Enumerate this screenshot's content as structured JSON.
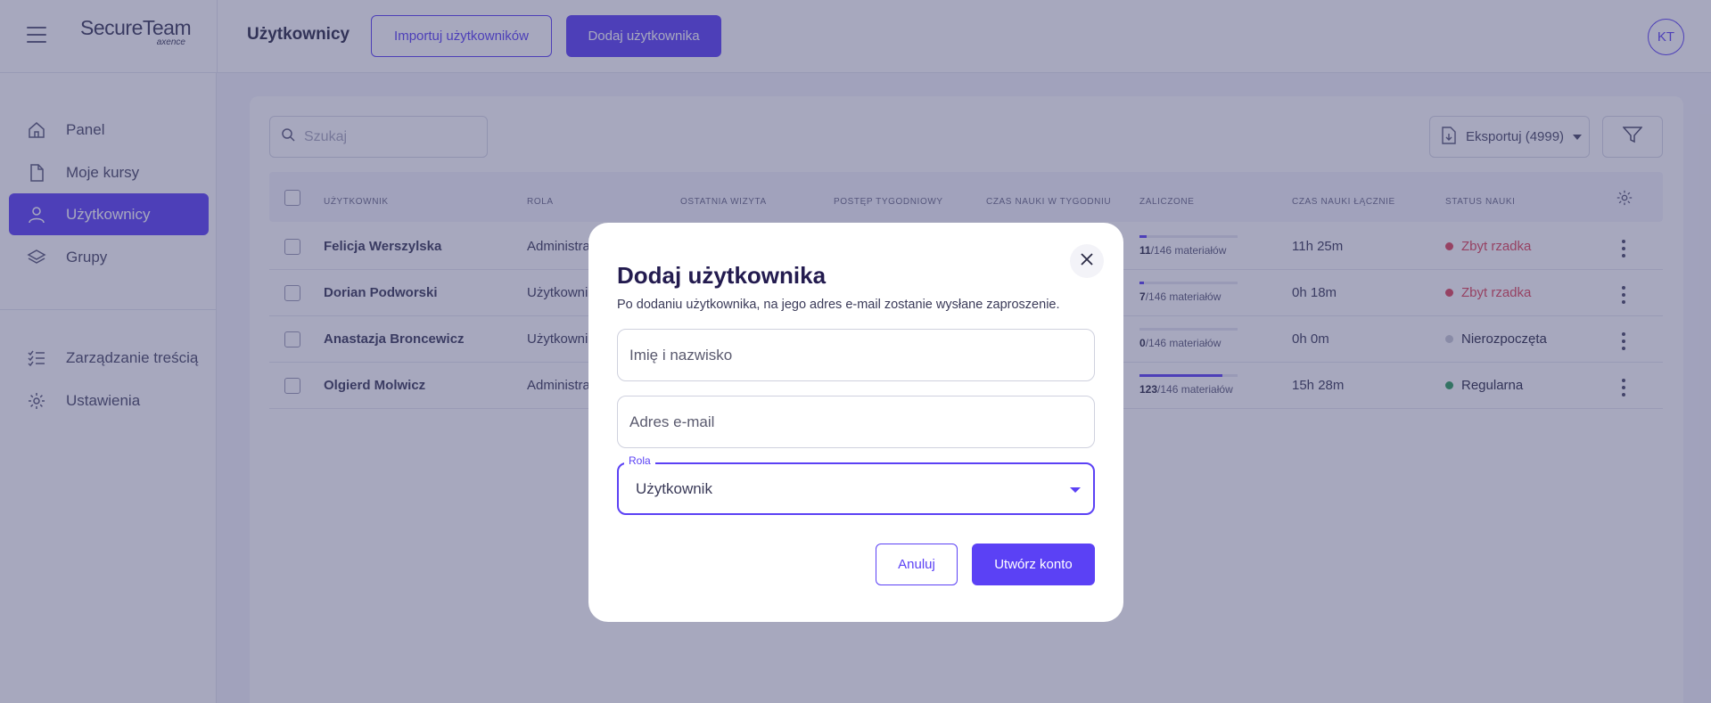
{
  "app": {
    "logo_main": "SecureTeam",
    "logo_sub": "axence",
    "page_title": "Użytkownicy",
    "import_label": "Importuj użytkowników",
    "add_label": "Dodaj użytkownika",
    "avatar_initials": "KT"
  },
  "sidebar": {
    "items": [
      {
        "label": "Panel",
        "icon": "home-icon"
      },
      {
        "label": "Moje kursy",
        "icon": "document-icon"
      },
      {
        "label": "Użytkownicy",
        "icon": "user-icon",
        "active": true
      },
      {
        "label": "Grupy",
        "icon": "layers-icon"
      },
      {
        "label": "Zarządzanie treścią",
        "icon": "list-check-icon"
      },
      {
        "label": "Ustawienia",
        "icon": "gear-icon"
      }
    ]
  },
  "toolbar": {
    "search_placeholder": "Szukaj",
    "export_label": "Eksportuj (4999)"
  },
  "table": {
    "headers": [
      "UŻYTKOWNIK",
      "ROLA",
      "OSTATNIA WIZYTA",
      "POSTĘP TYGODNIOWY",
      "CZAS NAUKI W TYGODNIU",
      "ZALICZONE",
      "CZAS NAUKI ŁĄCZNIE",
      "STATUS NAUKI"
    ],
    "rows": [
      {
        "name": "Felicja Werszylska",
        "role": "Administra",
        "completed": "11",
        "total": "/146 materiałów",
        "progress": 0.075,
        "total_time": "11h 25m",
        "status": "Zbyt rzadka",
        "status_color": "#e0455a"
      },
      {
        "name": "Dorian Podworski",
        "role": "Użytkowni",
        "completed": "7",
        "total": "/146 materiałów",
        "progress": 0.048,
        "total_time": "0h 18m",
        "status": "Zbyt rzadka",
        "status_color": "#e0455a"
      },
      {
        "name": "Anastazja Broncewicz",
        "role": "Użytkowni",
        "completed": "0",
        "total": "/146 materiałów",
        "progress": 0.0,
        "total_time": "0h 0m",
        "status": "Nierozpoczęta",
        "status_color": "#c9cad6"
      },
      {
        "name": "Olgierd Molwicz",
        "role": "Administra",
        "completed": "123",
        "total": "/146 materiałów",
        "progress": 0.842,
        "total_time": "15h 28m",
        "status": "Regularna",
        "status_color": "#2e9e5b"
      }
    ]
  },
  "modal": {
    "title": "Dodaj użytkownika",
    "description": "Po dodaniu użytkownika, na jego adres e-mail zostanie wysłane zaproszenie.",
    "name_placeholder": "Imię i nazwisko",
    "email_placeholder": "Adres e-mail",
    "role_label": "Rola",
    "role_value": "Użytkownik",
    "cancel_label": "Anuluj",
    "create_label": "Utwórz konto"
  },
  "colors": {
    "accent": "#5b41f5",
    "overlay": "rgba(60, 62, 110, 0.45)"
  }
}
